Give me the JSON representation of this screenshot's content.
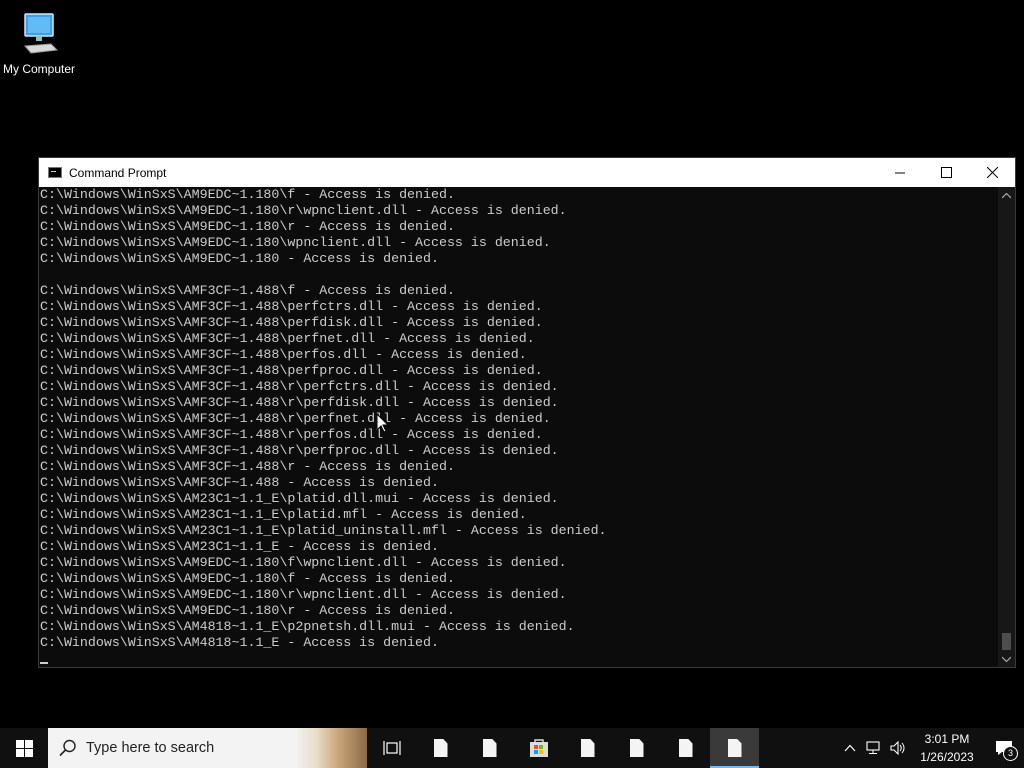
{
  "desktop": {
    "icons": [
      {
        "label": "My Computer",
        "icon": "computer-icon"
      }
    ]
  },
  "window": {
    "title": "Command Prompt",
    "lines": [
      "C:\\Windows\\WinSxS\\AM9EDC~1.180\\f - Access is denied.",
      "C:\\Windows\\WinSxS\\AM9EDC~1.180\\r\\wpnclient.dll - Access is denied.",
      "C:\\Windows\\WinSxS\\AM9EDC~1.180\\r - Access is denied.",
      "C:\\Windows\\WinSxS\\AM9EDC~1.180\\wpnclient.dll - Access is denied.",
      "C:\\Windows\\WinSxS\\AM9EDC~1.180 - Access is denied.",
      "",
      "C:\\Windows\\WinSxS\\AMF3CF~1.488\\f - Access is denied.",
      "C:\\Windows\\WinSxS\\AMF3CF~1.488\\perfctrs.dll - Access is denied.",
      "C:\\Windows\\WinSxS\\AMF3CF~1.488\\perfdisk.dll - Access is denied.",
      "C:\\Windows\\WinSxS\\AMF3CF~1.488\\perfnet.dll - Access is denied.",
      "C:\\Windows\\WinSxS\\AMF3CF~1.488\\perfos.dll - Access is denied.",
      "C:\\Windows\\WinSxS\\AMF3CF~1.488\\perfproc.dll - Access is denied.",
      "C:\\Windows\\WinSxS\\AMF3CF~1.488\\r\\perfctrs.dll - Access is denied.",
      "C:\\Windows\\WinSxS\\AMF3CF~1.488\\r\\perfdisk.dll - Access is denied.",
      "C:\\Windows\\WinSxS\\AMF3CF~1.488\\r\\perfnet.dll - Access is denied.",
      "C:\\Windows\\WinSxS\\AMF3CF~1.488\\r\\perfos.dll - Access is denied.",
      "C:\\Windows\\WinSxS\\AMF3CF~1.488\\r\\perfproc.dll - Access is denied.",
      "C:\\Windows\\WinSxS\\AMF3CF~1.488\\r - Access is denied.",
      "C:\\Windows\\WinSxS\\AMF3CF~1.488 - Access is denied.",
      "C:\\Windows\\WinSxS\\AM23C1~1.1_E\\platid.dll.mui - Access is denied.",
      "C:\\Windows\\WinSxS\\AM23C1~1.1_E\\platid.mfl - Access is denied.",
      "C:\\Windows\\WinSxS\\AM23C1~1.1_E\\platid_uninstall.mfl - Access is denied.",
      "C:\\Windows\\WinSxS\\AM23C1~1.1_E - Access is denied.",
      "C:\\Windows\\WinSxS\\AM9EDC~1.180\\f\\wpnclient.dll - Access is denied.",
      "C:\\Windows\\WinSxS\\AM9EDC~1.180\\f - Access is denied.",
      "C:\\Windows\\WinSxS\\AM9EDC~1.180\\r\\wpnclient.dll - Access is denied.",
      "C:\\Windows\\WinSxS\\AM9EDC~1.180\\r - Access is denied.",
      "C:\\Windows\\WinSxS\\AM4818~1.1_E\\p2pnetsh.dll.mui - Access is denied.",
      "C:\\Windows\\WinSxS\\AM4818~1.1_E - Access is denied."
    ]
  },
  "taskbar": {
    "search_placeholder": "Type here to search",
    "apps": [
      {
        "icon": "task-view-icon"
      },
      {
        "icon": "file-icon"
      },
      {
        "icon": "file-icon"
      },
      {
        "icon": "store-icon"
      },
      {
        "icon": "file-icon"
      },
      {
        "icon": "file-icon"
      },
      {
        "icon": "file-icon"
      },
      {
        "icon": "file-icon",
        "active": true
      }
    ],
    "time": "3:01 PM",
    "date": "1/26/2023",
    "notification_count": "3"
  },
  "colors": {
    "console_bg": "#0c0c0c",
    "console_text": "#cccccc",
    "accent": "#76b9ed"
  }
}
